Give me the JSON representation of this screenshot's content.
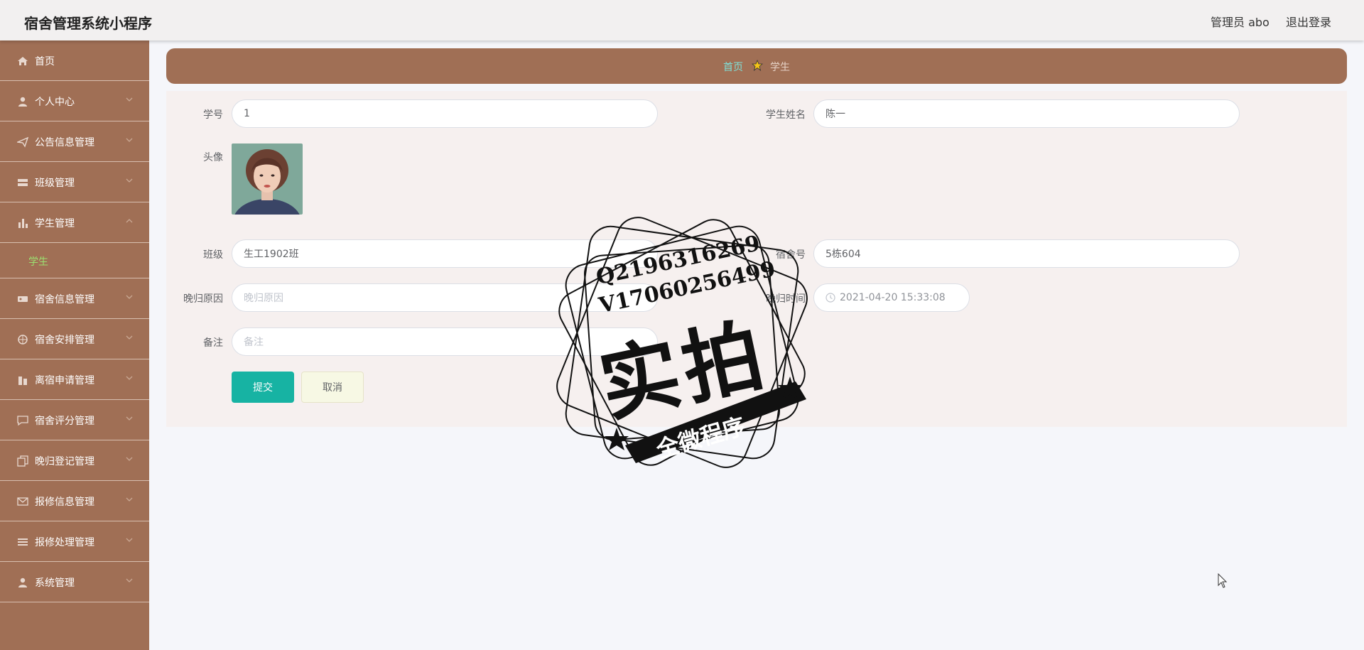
{
  "app": {
    "title": "宿舍管理系统小程序"
  },
  "header": {
    "admin_label": "管理员 abo",
    "logout_label": "退出登录"
  },
  "sidebar": {
    "items": [
      {
        "label": "首页",
        "icon": "home-icon",
        "has_children": false
      },
      {
        "label": "个人中心",
        "icon": "user-icon",
        "has_children": true
      },
      {
        "label": "公告信息管理",
        "icon": "send-icon",
        "has_children": true
      },
      {
        "label": "班级管理",
        "icon": "list-icon",
        "has_children": true
      },
      {
        "label": "学生管理",
        "icon": "bar-chart-icon",
        "has_children": true,
        "expanded": true
      },
      {
        "label": "宿舍信息管理",
        "icon": "ticket-icon",
        "has_children": true
      },
      {
        "label": "宿舍安排管理",
        "icon": "circle-icon",
        "has_children": true
      },
      {
        "label": "离宿申请管理",
        "icon": "building-icon",
        "has_children": true
      },
      {
        "label": "宿舍评分管理",
        "icon": "chat-icon",
        "has_children": true
      },
      {
        "label": "晚归登记管理",
        "icon": "copy-icon",
        "has_children": true
      },
      {
        "label": "报修信息管理",
        "icon": "mail-icon",
        "has_children": true
      },
      {
        "label": "报修处理管理",
        "icon": "menu-icon",
        "has_children": true
      },
      {
        "label": "系统管理",
        "icon": "person-icon",
        "has_children": true
      }
    ],
    "active_sub": {
      "label": "学生"
    }
  },
  "breadcrumb": {
    "home": "首页",
    "current": "学生"
  },
  "form": {
    "student_no": {
      "label": "学号",
      "value": "1"
    },
    "student_name": {
      "label": "学生姓名",
      "value": "陈一"
    },
    "avatar": {
      "label": "头像"
    },
    "class": {
      "label": "班级",
      "value": "生工1902班"
    },
    "dorm_no": {
      "label": "宿舍号",
      "value": "5栋604"
    },
    "late_reason": {
      "label": "晚归原因",
      "placeholder": "晚归原因"
    },
    "late_time": {
      "label": "晚归时间",
      "value": "2021-04-20 15:33:08"
    },
    "remark": {
      "label": "备注",
      "placeholder": "备注"
    },
    "submit_label": "提交",
    "cancel_label": "取消"
  },
  "watermark": {
    "line1": "Q2196316269",
    "line2": "V17060256499",
    "big": "实拍",
    "banner": "全微程序"
  },
  "colors": {
    "sidebar_bg": "#a06f55",
    "accent_teal": "#17b3a3",
    "active_sub": "#9be070",
    "breadcrumb_home": "#7fe0d8"
  }
}
